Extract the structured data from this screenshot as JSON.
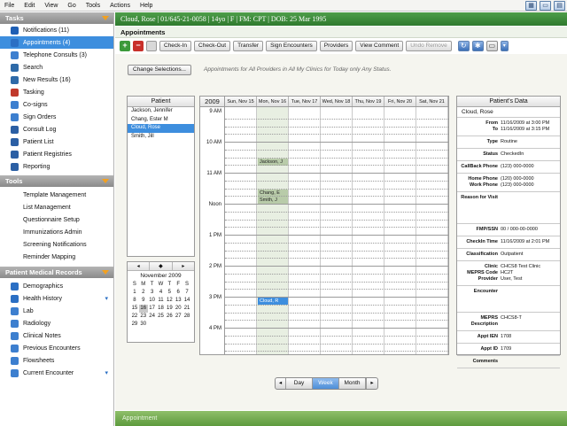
{
  "menu": [
    "File",
    "Edit",
    "View",
    "Go",
    "Tools",
    "Actions",
    "Help"
  ],
  "sidebar": {
    "tasks_header": "Tasks",
    "tasks": [
      {
        "label": "Notifications (11)",
        "icon": "info-icon",
        "color": "#1f5fb4"
      },
      {
        "label": "Appointments (4)",
        "icon": "calendar-icon",
        "color": "#2b6fc4",
        "selected": true
      },
      {
        "label": "Telephone Consults (3)",
        "icon": "telephone-icon",
        "color": "#3d7fcf"
      },
      {
        "label": "Search",
        "icon": "magnifier-icon",
        "color": "#2e6aa8"
      },
      {
        "label": "New Results (16)",
        "icon": "magnifier-icon",
        "color": "#2e6aa8"
      },
      {
        "label": "Tasking",
        "icon": "task-icon",
        "color": "#c0392b"
      },
      {
        "label": "Co-signs",
        "icon": "cosign-icon",
        "color": "#3d7fcf"
      },
      {
        "label": "Sign Orders",
        "icon": "sign-icon",
        "color": "#3d7fcf"
      },
      {
        "label": "Consult Log",
        "icon": "consult-log-icon",
        "color": "#2b5fa4"
      },
      {
        "label": "Patient List",
        "icon": "patient-list-icon",
        "color": "#2b5fa4"
      },
      {
        "label": "Patient Registries",
        "icon": "registries-icon",
        "color": "#2b5fa4"
      },
      {
        "label": "Reporting",
        "icon": "reporting-icon",
        "color": "#2b5fa4"
      }
    ],
    "tools_header": "Tools",
    "tools": [
      "Template Management",
      "List Management",
      "Questionnaire Setup",
      "Immunizations Admin",
      "Screening Notifications",
      "Reminder Mapping"
    ],
    "pmr_header": "Patient Medical Records",
    "pmr": [
      {
        "label": "Demographics",
        "icon": "demographics-icon",
        "color": "#2b6fc4"
      },
      {
        "label": "Health History",
        "icon": "health-history-icon",
        "color": "#2b6fc4",
        "dropdown": true
      },
      {
        "label": "Lab",
        "icon": "lab-icon",
        "color": "#3d7fcf"
      },
      {
        "label": "Radiology",
        "icon": "radiology-icon",
        "color": "#3d7fcf"
      },
      {
        "label": "Clinical Notes",
        "icon": "clinical-notes-icon",
        "color": "#3d7fcf"
      },
      {
        "label": "Previous Encounters",
        "icon": "previous-encounters-icon",
        "color": "#3d7fcf"
      },
      {
        "label": "Flowsheets",
        "icon": "flowsheets-icon",
        "color": "#3d7fcf"
      },
      {
        "label": "Current Encounter",
        "icon": "current-encounter-icon",
        "color": "#3d7fcf",
        "dropdown": true
      }
    ]
  },
  "banner": "Cloud, Rose | 01/645-21-0058 | 14yo | F | FM: CPT | DOB: 25 Mar 1995",
  "section_title": "Appointments",
  "toolbar": {
    "buttons": [
      "Check-In",
      "Check-Out",
      "Transfer",
      "Sign Encounters",
      "Providers",
      "View Comment",
      "Undo Remove"
    ]
  },
  "change_selections": "Change Selections...",
  "filter_text": "Appointments for All Providers in All My Clinics for Today only Any Status.",
  "patient_panel": {
    "header": "Patient",
    "rows": [
      "Jackson, Jennifer",
      "Chang, Ester M",
      "Cloud, Rose",
      "Smith, Jill"
    ],
    "selected": 2
  },
  "minical": {
    "nav": [
      "◂",
      "◆",
      "▸"
    ],
    "month": "November 2009",
    "weekdays": [
      "S",
      "M",
      "T",
      "W",
      "T",
      "F",
      "S"
    ],
    "days": [
      "1",
      "2",
      "3",
      "4",
      "5",
      "6",
      "7",
      "8",
      "9",
      "10",
      "11",
      "12",
      "13",
      "14",
      "15",
      "16",
      "17",
      "18",
      "19",
      "20",
      "21",
      "22",
      "23",
      "24",
      "25",
      "26",
      "27",
      "28",
      "29",
      "30"
    ],
    "today": "16"
  },
  "schedule": {
    "year": "2009",
    "days": [
      "Sun, Nov 15",
      "Mon, Nov 16",
      "Tue, Nov 17",
      "Wed, Nov 18",
      "Thu, Nov 19",
      "Fri, Nov 20",
      "Sat, Nov 21"
    ],
    "highlight_day": 1,
    "times": [
      "9 AM",
      "10 AM",
      "11 AM",
      "Noon",
      "1 PM",
      "2 PM",
      "3 PM",
      "4 PM"
    ],
    "appointments": [
      {
        "label": "Jackson, J",
        "day": 1,
        "hour": 10.5,
        "style": "green"
      },
      {
        "label": "Chang, E",
        "day": 1,
        "hour": 11.5,
        "style": "green"
      },
      {
        "label": "Smith, J",
        "day": 1,
        "hour": 11.75,
        "style": "green"
      },
      {
        "label": "Cloud, R",
        "day": 1,
        "hour": 15.0,
        "style": "blue"
      }
    ]
  },
  "patient_data": {
    "header": "Patient's Data",
    "name": "Cloud, Rose",
    "groups": [
      [
        {
          "label": "From",
          "value": "11/16/2009 at 3:00 PM"
        },
        {
          "label": "To",
          "value": "11/16/2009 at 3:15 PM"
        }
      ],
      [
        {
          "label": "Type",
          "value": "Routine"
        }
      ],
      [
        {
          "label": "Status",
          "value": "CheckedIn"
        }
      ],
      [
        {
          "label": "CallBack Phone",
          "value": "(123) 000-0000"
        }
      ],
      [
        {
          "label": "Home Phone",
          "value": "(120) 000-0000"
        },
        {
          "label": "Work Phone",
          "value": "(123) 000-0000"
        }
      ],
      [
        {
          "label": "Reason for Visit",
          "value": ""
        }
      ],
      [
        {
          "label": "FMP/SSN",
          "value": "00 / 000-00-0000"
        }
      ],
      [
        {
          "label": "CheckIn Time",
          "value": "11/16/2009 at 2:01 PM"
        }
      ],
      [
        {
          "label": "Classification",
          "value": "Outpatient"
        }
      ],
      [
        {
          "label": "Clinic",
          "value": "CHCS8 Test Clinic"
        },
        {
          "label": "MEPRS Code",
          "value": "HC2T"
        },
        {
          "label": "Provider",
          "value": "User, Test"
        }
      ],
      [
        {
          "label": "Encounter",
          "value": ""
        }
      ],
      [
        {
          "label": "MEPRS Description",
          "value": "CHCS8-T"
        }
      ],
      [
        {
          "label": "Appt IEN",
          "value": "1708"
        }
      ],
      [
        {
          "label": "Appt ID",
          "value": "1709"
        }
      ],
      [
        {
          "label": "Comments",
          "value": ""
        }
      ]
    ]
  },
  "view_switch": {
    "prev": "◂",
    "next": "▸",
    "options": [
      "Day",
      "Week",
      "Month"
    ],
    "active": 1
  },
  "bottom_bar": "Appointment",
  "colors": {
    "accent_green": "#2f7a2e",
    "selection_blue": "#3d8ede",
    "header_orange": "#f2a020"
  }
}
